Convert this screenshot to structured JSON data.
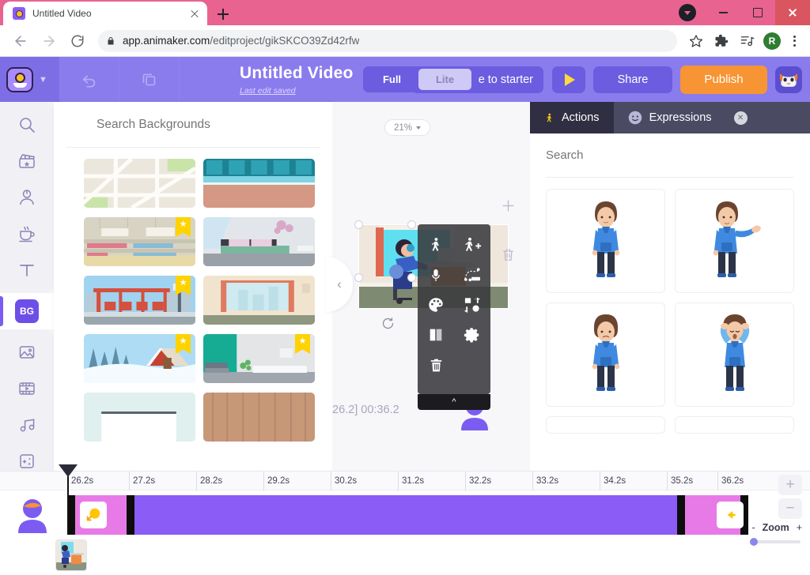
{
  "browser": {
    "tab": {
      "title": "Untitled Video",
      "favicon": "animaker-icon",
      "close": "close-icon"
    },
    "new_tab": "+",
    "window_controls": {
      "dropdown": "chevron-down-icon",
      "minimize": "minimize-icon",
      "maximize": "maximize-icon",
      "close": "close-icon"
    },
    "nav": {
      "back": "back-arrow-icon",
      "forward": "forward-arrow-icon",
      "reload": "reload-icon"
    },
    "omnibox": {
      "lock": "lock-icon",
      "url_domain": "app.animaker.com",
      "url_path": "/editproject/gikSKCO39Zd42rfw"
    },
    "toolbar_icons": [
      "bookmark-star-icon",
      "extensions-icon",
      "media-control-icon"
    ],
    "profile": "R",
    "menu": "kebab-menu-icon",
    "theme_color": "#e8638f"
  },
  "app_header": {
    "logo": "animaker-logo",
    "logo_chevron": "chevron-down-icon",
    "tools": [
      "undo-icon",
      "duplicate-icon"
    ],
    "project_title": "Untitled Video",
    "save_status": "Last edit saved",
    "mode_toggle": {
      "options": [
        "Full",
        "Lite"
      ],
      "selected": "Full"
    },
    "upgrade_label": "e to starter",
    "play": "play-icon",
    "share_label": "Share",
    "publish_label": "Publish",
    "avatar": "dog-avatar",
    "accent_publish": "#f79433",
    "accent_bg": "#8b7ced"
  },
  "rail": {
    "items": [
      {
        "name": "search",
        "icon": "search-icon",
        "active": false
      },
      {
        "name": "scenes",
        "icon": "clapperboard-icon",
        "active": false
      },
      {
        "name": "characters",
        "icon": "character-icon",
        "active": false
      },
      {
        "name": "props",
        "icon": "prop-cup-icon",
        "active": false
      },
      {
        "name": "text",
        "icon": "text-icon",
        "active": false
      },
      {
        "name": "backgrounds",
        "icon": "bg-icon",
        "label": "BG",
        "active": true
      },
      {
        "name": "images",
        "icon": "image-icon",
        "active": false
      },
      {
        "name": "videos",
        "icon": "video-icon",
        "active": false
      },
      {
        "name": "music",
        "icon": "music-icon",
        "active": false
      },
      {
        "name": "effects",
        "icon": "effects-icon",
        "active": false
      }
    ]
  },
  "bg_panel": {
    "search_placeholder": "Search Backgrounds",
    "thumbnails": [
      {
        "id": "map",
        "premium": false
      },
      {
        "id": "pool",
        "premium": false
      },
      {
        "id": "store-shelves",
        "premium": true
      },
      {
        "id": "bedroom",
        "premium": false
      },
      {
        "id": "bus-stop",
        "premium": true
      },
      {
        "id": "window-curtains",
        "premium": false
      },
      {
        "id": "snow-cabin",
        "premium": true
      },
      {
        "id": "green-wall-room",
        "premium": true
      },
      {
        "id": "pale-room",
        "premium": false
      },
      {
        "id": "wood-floor",
        "premium": false
      }
    ]
  },
  "canvas": {
    "zoom_level": "21%",
    "zoom_chevron": "chevron-down-icon",
    "collapse": "chevron-left-icon",
    "rotate": "rotate-icon",
    "add": "plus-icon",
    "delete": "trash-icon",
    "time_label": "26.2]  00:36.2",
    "context_menu": {
      "items": [
        "action-walk-icon",
        "add-action-icon",
        "microphone-icon",
        "motion-path-icon",
        "palette-icon",
        "swap-icon",
        "flip-icon",
        "settings-gear-icon",
        "trash-icon"
      ],
      "collapse": "chevron-up-icon"
    }
  },
  "right_panel": {
    "tabs": [
      {
        "label": "Actions",
        "icon": "walking-person-icon",
        "active": true
      },
      {
        "label": "Expressions",
        "icon": "smiley-icon",
        "active": false
      }
    ],
    "close": "close-icon",
    "search_placeholder": "Search",
    "poses": [
      {
        "id": "idle-standing"
      },
      {
        "id": "presenting-hand-out"
      },
      {
        "id": "standing-sad"
      },
      {
        "id": "hands-on-head"
      },
      {
        "id": "row3-left"
      },
      {
        "id": "row3-right"
      }
    ]
  },
  "timeline": {
    "ticks": [
      "26.2s",
      "27.2s",
      "28.2s",
      "29.2s",
      "30.2s",
      "31.2s",
      "32.2s",
      "33.2s",
      "34.2s",
      "35.2s",
      "36.2s"
    ],
    "playhead_time": "26.2s",
    "track_avatar": "character-avatar-icon",
    "clips": [
      {
        "id": "enter-clip",
        "color": "#e87ae8",
        "thumb": "enter-effect-icon"
      },
      {
        "id": "main-clip",
        "color": "#8b5cf6"
      },
      {
        "id": "exit-clip",
        "color": "#e87ae8",
        "thumb": "exit-effect-icon"
      }
    ],
    "scene_thumb": "scene-office-thumbnail",
    "zoom_in": "+",
    "zoom_out": "−",
    "zoom_label": "Zoom",
    "zoom_minus": "-",
    "zoom_plus": "+"
  }
}
